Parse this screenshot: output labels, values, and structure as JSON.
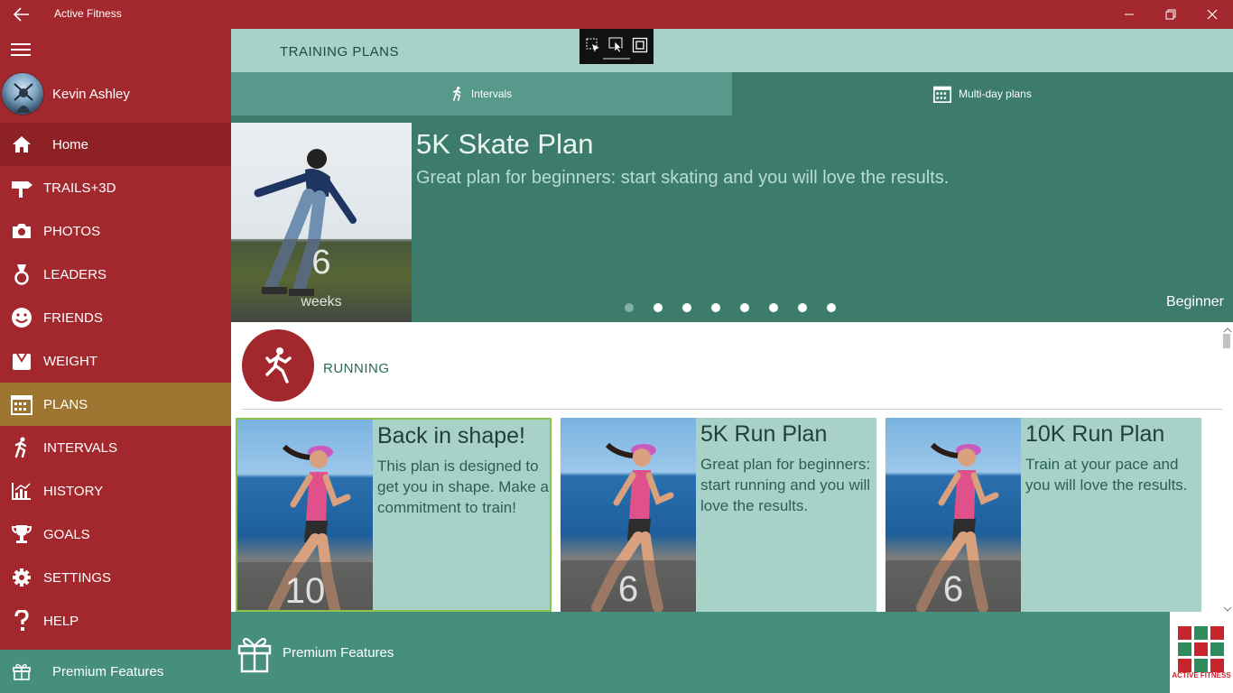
{
  "window": {
    "title": "Active Fitness"
  },
  "sidebar": {
    "profile_name": "Kevin Ashley",
    "items": [
      {
        "label": "Home",
        "icon": "home-icon"
      },
      {
        "label": "TRAILS+3D",
        "icon": "signpost-icon"
      },
      {
        "label": "PHOTOS",
        "icon": "camera-icon"
      },
      {
        "label": "LEADERS",
        "icon": "medal-icon"
      },
      {
        "label": "FRIENDS",
        "icon": "smiley-icon"
      },
      {
        "label": "WEIGHT",
        "icon": "scale-icon"
      },
      {
        "label": "PLANS",
        "icon": "calendar-icon"
      },
      {
        "label": "INTERVALS",
        "icon": "runner-icon"
      },
      {
        "label": "HISTORY",
        "icon": "chart-icon"
      },
      {
        "label": "GOALS",
        "icon": "trophy-icon"
      },
      {
        "label": "SETTINGS",
        "icon": "gear-icon"
      },
      {
        "label": "HELP",
        "icon": "question-icon"
      }
    ],
    "premium_label": "Premium Features",
    "active_item": "PLANS"
  },
  "header": {
    "title": "TRAINING PLANS"
  },
  "tabs": [
    {
      "label": "Intervals",
      "icon": "runner-icon"
    },
    {
      "label": "Multi-day plans",
      "icon": "calendar-icon"
    }
  ],
  "hero": {
    "title": "5K Skate Plan",
    "description": "Great plan for beginners: start skating and you will love the results.",
    "duration_value": "6",
    "duration_unit": "weeks",
    "level": "Beginner",
    "pager_count": 8,
    "pager_active": 0
  },
  "section": {
    "title": "RUNNING",
    "icon": "running-woman-icon"
  },
  "cards": [
    {
      "title": "Back in shape!",
      "description": "This plan is designed to get you in shape. Make a commitment to train!",
      "number": "10"
    },
    {
      "title": "5K Run Plan",
      "description": "Great plan for beginners: start running and you will love the results.",
      "number": "6"
    },
    {
      "title": "10K Run Plan",
      "description": "Train at your pace and you will love the results.",
      "number": "6"
    }
  ],
  "bottom": {
    "premium_label": "Premium Features",
    "logo_text": "ACTIVE FITNESS"
  },
  "colors": {
    "brand_red": "#a3282e",
    "teal_dark": "#3d7b6b",
    "teal_light": "#a8d2c7",
    "plans_highlight": "#9d7430"
  }
}
